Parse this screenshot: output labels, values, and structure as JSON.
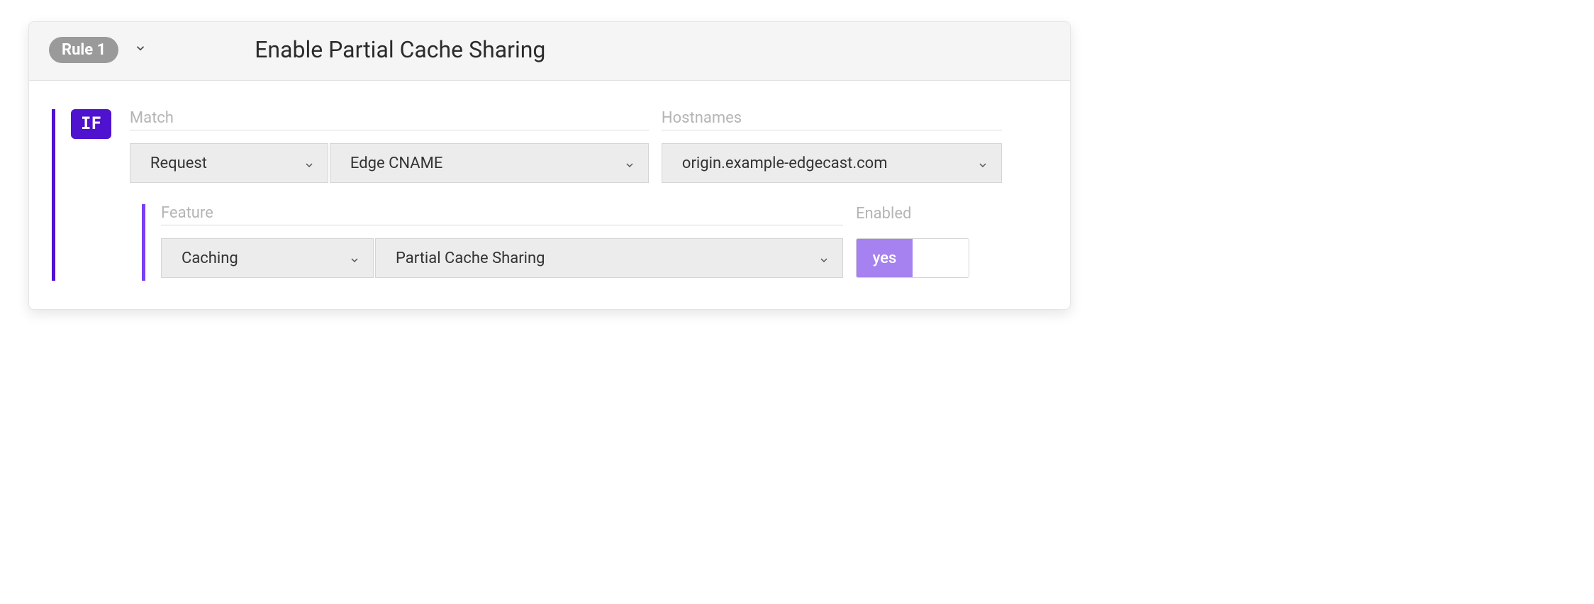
{
  "rule": {
    "badge": "Rule 1",
    "title": "Enable Partial Cache Sharing"
  },
  "condition": {
    "if_tag": "IF",
    "match_label": "Match",
    "hostnames_label": "Hostnames",
    "category": "Request",
    "property": "Edge CNAME",
    "hostname": "origin.example-edgecast.com"
  },
  "feature": {
    "feature_label": "Feature",
    "enabled_label": "Enabled",
    "category": "Caching",
    "name": "Partial Cache Sharing",
    "enabled_text": "yes"
  }
}
